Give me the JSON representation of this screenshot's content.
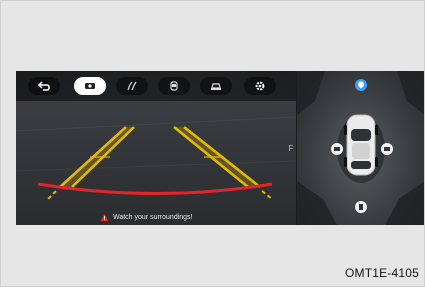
{
  "screen": {
    "toolbar": {
      "buttons": [
        {
          "name": "back",
          "icon": "back-arrow-icon",
          "active": false
        },
        {
          "name": "rear-view-camera",
          "icon": "rear-camera-icon",
          "active": true
        },
        {
          "name": "guideline-toggle",
          "icon": "steering-guideline-icon",
          "active": false
        },
        {
          "name": "top-view",
          "icon": "car-top-view-icon",
          "active": false
        },
        {
          "name": "front-view",
          "icon": "car-front-view-icon",
          "active": false
        },
        {
          "name": "settings",
          "icon": "gear-icon",
          "active": false
        }
      ]
    },
    "side_tab_label": "F",
    "warning_text": "Watch your surroundings!",
    "bird_eye": {
      "camera_pins": [
        "front-camera-pin",
        "left-camera-pin",
        "right-camera-pin",
        "rear-camera-pin"
      ]
    }
  },
  "caption": "OMT1E-4105",
  "colors": {
    "guideline_yellow": "#e6b800",
    "guideline_red": "#e0262a",
    "active_button": "#ffffff",
    "warning_red": "#e0262a"
  }
}
